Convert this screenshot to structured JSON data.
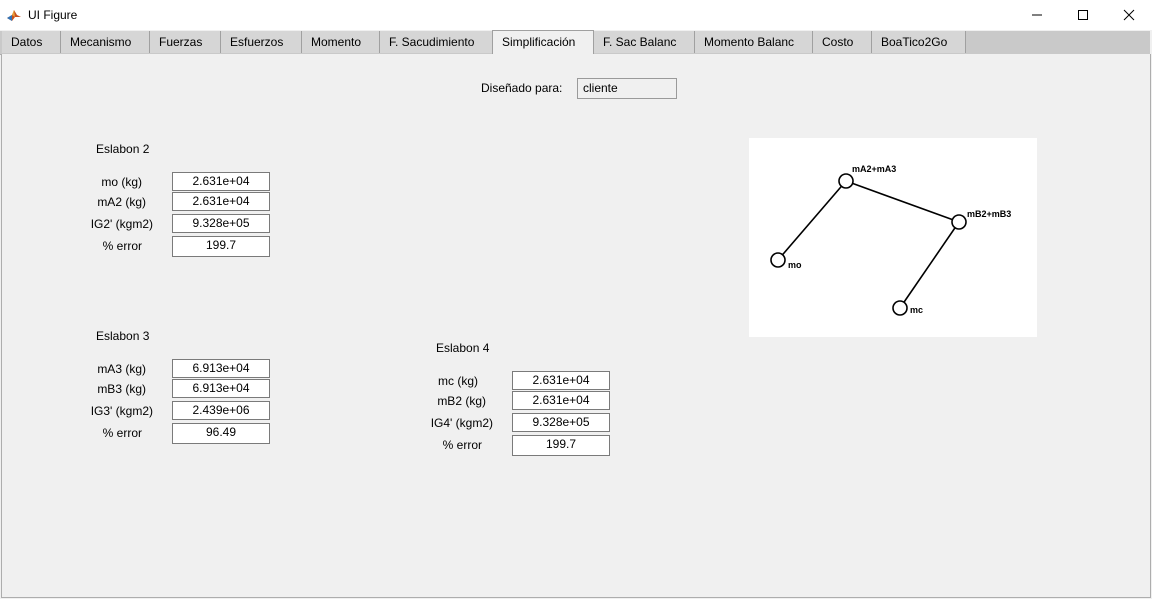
{
  "window": {
    "title": "UI Figure"
  },
  "tabs": [
    "Datos",
    "Mecanismo",
    "Fuerzas",
    "Esfuerzos",
    "Momento",
    "F. Sacudimiento",
    "Simplificación",
    "F. Sac Balanc",
    "Momento Balanc",
    "Costo",
    "BoaTico2Go"
  ],
  "active_tab": "Simplificación",
  "designed_for": {
    "label": "Diseñado para:",
    "value": "cliente"
  },
  "link2": {
    "title": "Eslabon 2",
    "rows": [
      {
        "label": "mo (kg)",
        "value": "2.631e+04"
      },
      {
        "label": "mA2 (kg)",
        "value": "2.631e+04"
      },
      {
        "label": "IG2' (kgm2)",
        "value": "9.328e+05"
      },
      {
        "label": "% error",
        "value": "199.7"
      }
    ]
  },
  "link3": {
    "title": "Eslabon 3",
    "rows": [
      {
        "label": "mA3 (kg)",
        "value": "6.913e+04"
      },
      {
        "label": "mB3 (kg)",
        "value": "6.913e+04"
      },
      {
        "label": "IG3' (kgm2)",
        "value": "2.439e+06"
      },
      {
        "label": "% error",
        "value": "96.49"
      }
    ]
  },
  "link4": {
    "title": "Eslabon 4",
    "rows": [
      {
        "label": "mc (kg)",
        "value": "2.631e+04"
      },
      {
        "label": "mB2 (kg)",
        "value": "2.631e+04"
      },
      {
        "label": "IG4' (kgm2)",
        "value": "9.328e+05"
      },
      {
        "label": "% error",
        "value": "199.7"
      }
    ]
  },
  "diagram": {
    "labels": {
      "a": "mA2+mA3",
      "b": "mB2+mB3",
      "o": "mo",
      "c": "mc"
    }
  },
  "icons": {
    "app": "matlab-icon",
    "minimize": "minimize-icon",
    "maximize": "maximize-icon",
    "close": "close-icon"
  }
}
